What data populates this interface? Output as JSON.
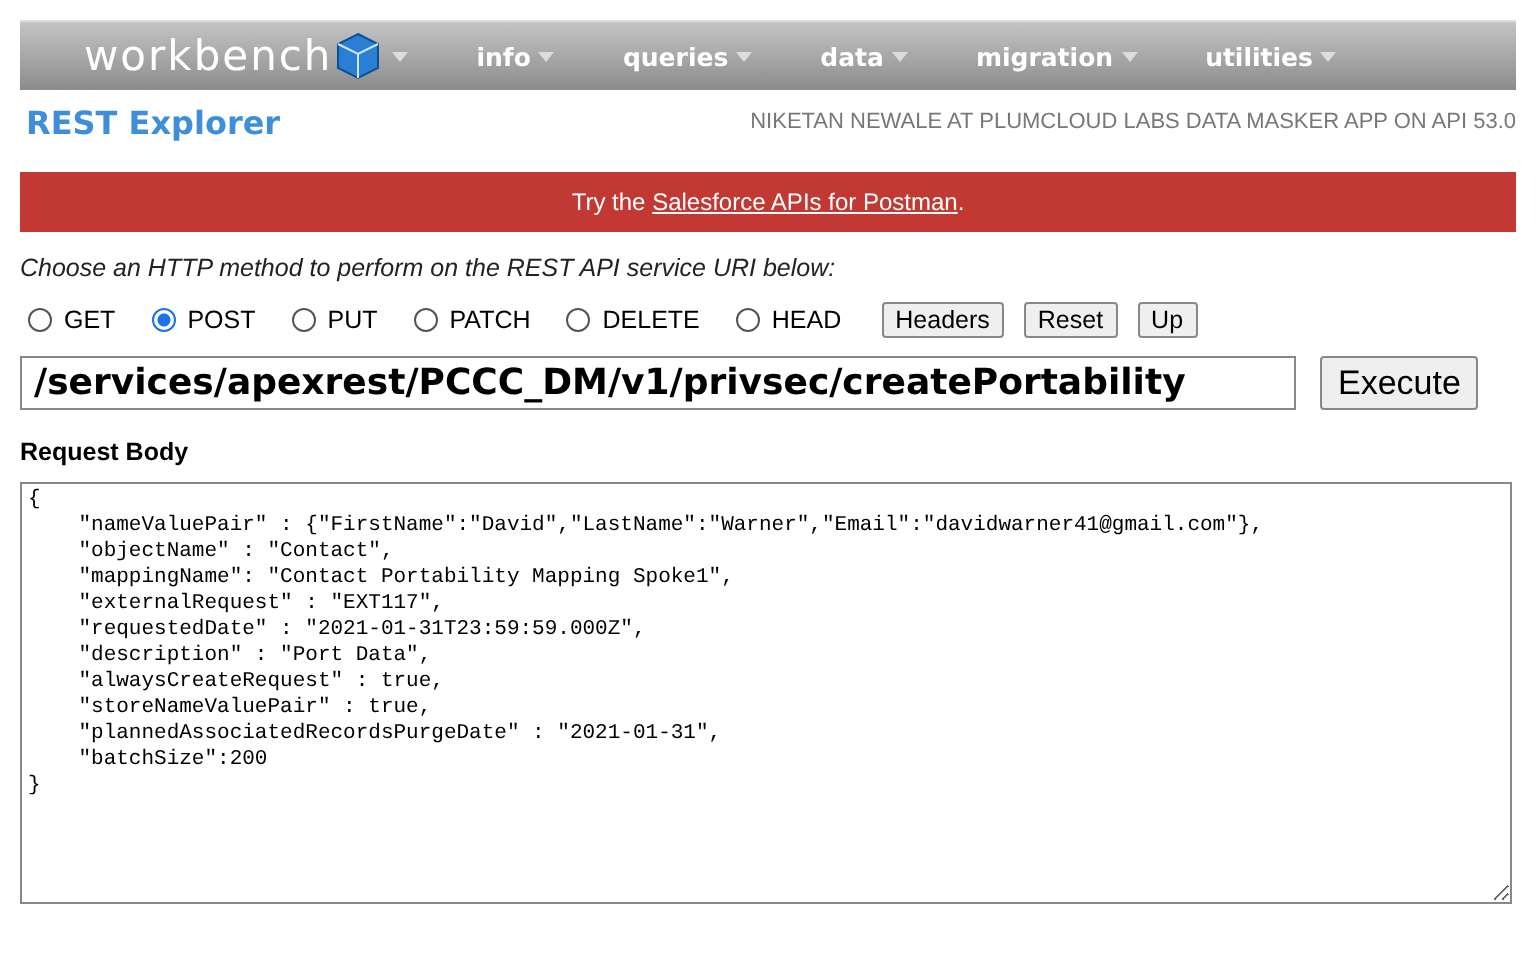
{
  "nav": {
    "logo": "workbench",
    "menus": [
      {
        "label": "info"
      },
      {
        "label": "queries"
      },
      {
        "label": "data"
      },
      {
        "label": "migration"
      },
      {
        "label": "utilities"
      }
    ]
  },
  "page_title": "REST Explorer",
  "user_info": "NIKETAN NEWALE AT PLUMCLOUD LABS DATA MASKER APP ON API 53.0",
  "banner": {
    "before": "Try the ",
    "link": "Salesforce APIs for Postman",
    "after": "."
  },
  "prompt": "Choose an HTTP method to perform on the REST API service URI below:",
  "methods": [
    {
      "label": "GET",
      "selected": false
    },
    {
      "label": "POST",
      "selected": true
    },
    {
      "label": "PUT",
      "selected": false
    },
    {
      "label": "PATCH",
      "selected": false
    },
    {
      "label": "DELETE",
      "selected": false
    },
    {
      "label": "HEAD",
      "selected": false
    }
  ],
  "tool_buttons": [
    "Headers",
    "Reset",
    "Up"
  ],
  "uri": "/services/apexrest/PCCC_DM/v1/privsec/createPortability",
  "execute": "Execute",
  "body_label": "Request Body",
  "body_lines": [
    "{",
    "    \"nameValuePair\" : {\"FirstName\":\"David\",\"LastName\":\"Warner\",\"Email\":\"davidwarner41@gmail.com\"},",
    "    \"objectName\" : \"Contact\",",
    "    \"mappingName\": \"Contact Portability Mapping Spoke1\",",
    "    \"externalRequest\" : \"EXT117\",",
    "    \"requestedDate\" : \"2021-01-31T23:59:59.000Z\",",
    "    \"description\" : \"Port Data\",",
    "    \"alwaysCreateRequest\" : true,",
    "    \"storeNameValuePair\" : true,",
    "    \"plannedAssociatedRecordsPurgeDate\" : \"2021-01-31\",",
    "    \"batchSize\":200",
    "}"
  ]
}
